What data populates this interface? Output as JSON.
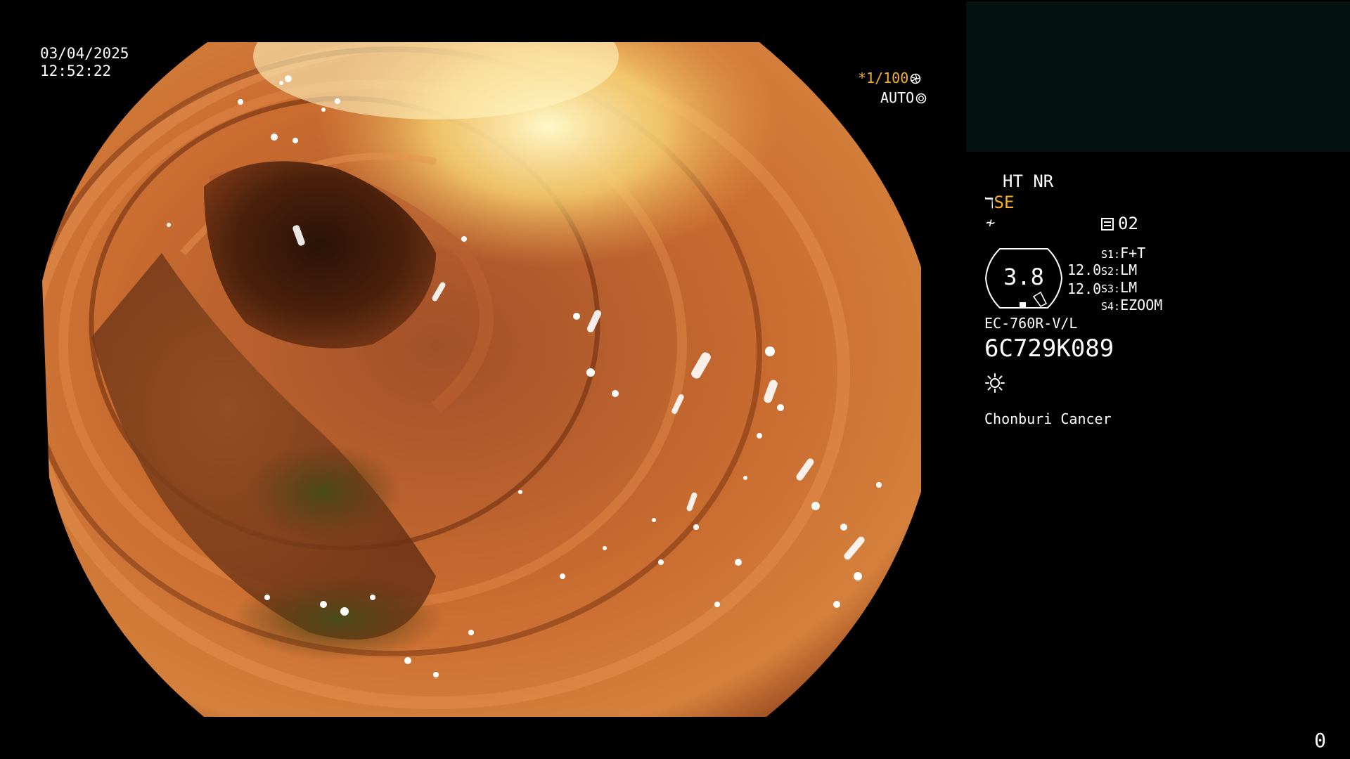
{
  "overlay": {
    "date": "03/04/2025",
    "time": "12:52:22",
    "shutter": "*1/100",
    "iris_mode": "AUTO"
  },
  "panel": {
    "mode_line": "HT NR",
    "enhancement": "SE",
    "memory_label": "02",
    "gauge_value": "3.8",
    "gain_upper": "12.0",
    "gain_lower": "12.0",
    "switches": [
      {
        "key": "S1:",
        "value": "F+T"
      },
      {
        "key": "S2:",
        "value": "LM"
      },
      {
        "key": "S3:",
        "value": "LM"
      },
      {
        "key": "S4:",
        "value": "EZOOM"
      }
    ],
    "scope_model": "EC-760R-V/L",
    "scope_serial": "6C729K089",
    "institution": "Chonburi Cancer",
    "icons": [
      "hook-icon",
      "curve-icon",
      "memory-icon",
      "light-icon",
      "shutter-icon",
      "iris-icon"
    ]
  },
  "footer": {
    "counter": "0"
  },
  "colors": {
    "accent_orange": "#f5b02a",
    "panel_box": "#04120f",
    "mucosa": "#c8682c"
  }
}
